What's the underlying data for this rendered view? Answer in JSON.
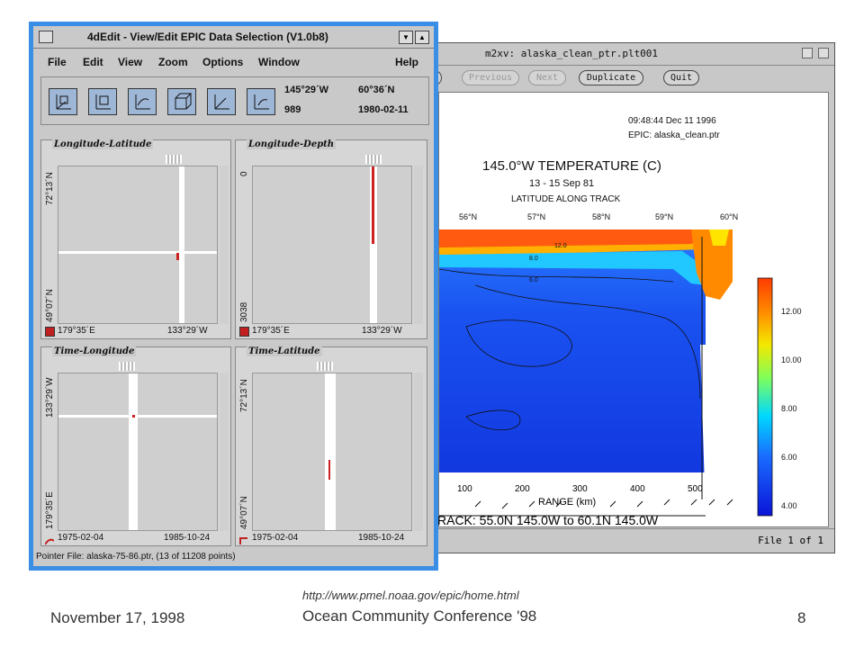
{
  "back_window": {
    "title": "m2xv: alaska_clean_ptr.plt001",
    "buttons": {
      "previous": "Previous",
      "next": "Next",
      "duplicate": "Duplicate",
      "quit": "Quit"
    },
    "status": "File 1 of 1",
    "plot": {
      "timestamp": "09:48:44 Dec 11 1996",
      "epic_file": "EPIC: alaska_clean.ptr",
      "title": "145.0°W TEMPERATURE (C)",
      "dates": "13 - 15 Sep 81",
      "top_axis_label": "LATITUDE ALONG TRACK",
      "top_ticks": [
        "56°N",
        "57°N",
        "58°N",
        "59°N",
        "60°N"
      ],
      "bottom_ticks": [
        "100",
        "200",
        "300",
        "400",
        "500"
      ],
      "xlabel": "RANGE (km)",
      "track": "RACK: 55.0N 145.0W to 60.1N 145.0W",
      "colorbar_ticks": [
        "12.00",
        "10.00",
        "8.00",
        "6.00",
        "4.00"
      ],
      "contour_labels": [
        "12.0",
        "8.0",
        "6.0"
      ]
    }
  },
  "front_window": {
    "title": "4dEdit - View/Edit EPIC Data Selection (V1.0b8)",
    "menu": [
      "File",
      "Edit",
      "View",
      "Zoom",
      "Options",
      "Window",
      "Help"
    ],
    "readout": {
      "lon": "145°29´W",
      "lat": "60°36´N",
      "depth": "989",
      "date": "1980-02-11"
    },
    "panels": [
      {
        "title": "Longitude-Latitude",
        "ytop": "72°13´N",
        "ybottom": "49°07´N",
        "xleft": "179°35´E",
        "xright": "133°29´W"
      },
      {
        "title": "Longitude-Depth",
        "ytop": "0",
        "ybottom": "3038",
        "xleft": "179°35´E",
        "xright": "133°29´W"
      },
      {
        "title": "Time-Longitude",
        "ytop": "133°29´W",
        "ybottom": "179°35´E",
        "xleft": "1975-02-04",
        "xright": "1985-10-24"
      },
      {
        "title": "Time-Latitude",
        "ytop": "72°13´N",
        "ybottom": "49°07´N",
        "xleft": "1975-02-04",
        "xright": "1985-10-24"
      }
    ],
    "status": "Pointer File: alaska-75-86.ptr, (13 of 11208 points)"
  },
  "slide": {
    "url": "http://www.pmel.noaa.gov/epic/home.html",
    "date": "November 17, 1998",
    "conference": "Ocean Community Conference '98",
    "page": "8"
  },
  "colors": {
    "accent": "#3a8ee6",
    "selection": "#cc2222"
  }
}
